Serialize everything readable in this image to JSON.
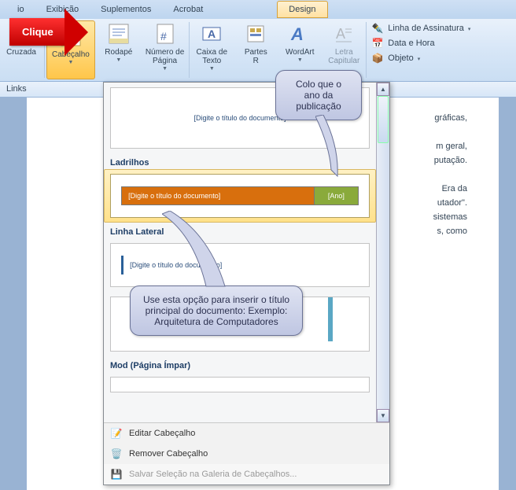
{
  "tabs": {
    "t1": "io",
    "t2": "Exibição",
    "t3": "Suplementos",
    "t4": "Acrobat",
    "t5": "Design"
  },
  "ribbon": {
    "cruzada": "Cruzada",
    "cabecalho": "Cabeçalho",
    "rodape": "Rodapé",
    "numpag": "Número de\nPágina",
    "caixa": "Caixa de\nTexto",
    "partes": "Partes\nR",
    "wordart": "WordArt",
    "letra": "Letra\nCapitular",
    "assinatura": "Linha de Assinatura",
    "datahora": "Data e Hora",
    "objeto": "Objeto"
  },
  "links": "Links",
  "gallery": {
    "item1_text": "[Digite o título do documento]",
    "g2_title": "Ladrilhos",
    "g2_t": "[Digite o título do documento]",
    "g2_y": "[Ano]",
    "g3_title": "Linha Lateral",
    "g3_text": "[Digite o título do documento]",
    "g5_title": "Mod (Página Ímpar)"
  },
  "menu": {
    "edit": "Editar Cabeçalho",
    "remove": "Remover Cabeçalho",
    "save": "Salvar Seleção na Galeria de Cabeçalhos..."
  },
  "callouts": {
    "c1": "Colo que o ano da publicação",
    "c2": "Use esta opção para inserir o título principal do documento: Exemplo: Arquitetura de Computadores"
  },
  "arrow": "Clique",
  "page": {
    "l1": "gráficas,",
    "l2": "m geral,",
    "l3": "putação.",
    "l4": "Era da",
    "l5": "utador\".",
    "l6": "sistemas",
    "l7": "s, como"
  }
}
